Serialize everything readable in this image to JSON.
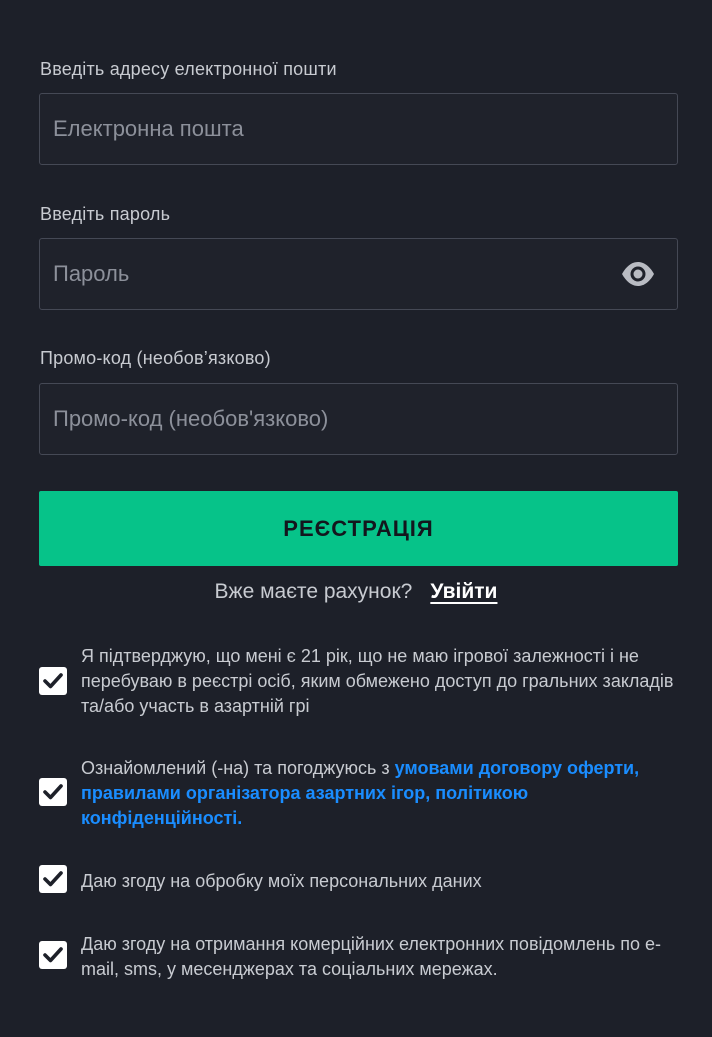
{
  "form": {
    "email": {
      "label": "Введіть адресу електронної пошти",
      "placeholder": "Електронна пошта",
      "value": ""
    },
    "password": {
      "label": "Введіть пароль",
      "placeholder": "Пароль",
      "value": "",
      "toggle_icon": "eye-icon"
    },
    "promo": {
      "label": "Промо-код (необов’язково)",
      "placeholder": "Промо-код (необов'язково)",
      "value": ""
    },
    "register_label": "РЕЄСТРАЦІЯ",
    "have_account_text": "Вже маєте рахунок?",
    "login_link": "Увійти"
  },
  "consents": [
    {
      "checked": true,
      "text": "Я підтверджую, що мені є 21 рік, що не маю ігрової залежності і не перебуваю в реєстрі осіб, яким обмежено доступ до гральних закладів та/або участь в азартній грі"
    },
    {
      "checked": true,
      "text_before": "Ознайомлений (-на) та погоджуюсь з ",
      "link_text": "умовами договору оферти, правилами організатора азартних ігор, політикою конфіденційності."
    },
    {
      "checked": true,
      "text": "Даю згоду на обробку моїх персональних даних"
    },
    {
      "checked": true,
      "text": "Даю згоду на отримання комерційних електронних повідомлень по e-mail, sms, у месенджерах та соціальних мережах."
    }
  ],
  "colors": {
    "background": "#1d2029",
    "accent_green": "#06c389",
    "link_blue": "#1a8dff",
    "field_border": "#454955"
  }
}
